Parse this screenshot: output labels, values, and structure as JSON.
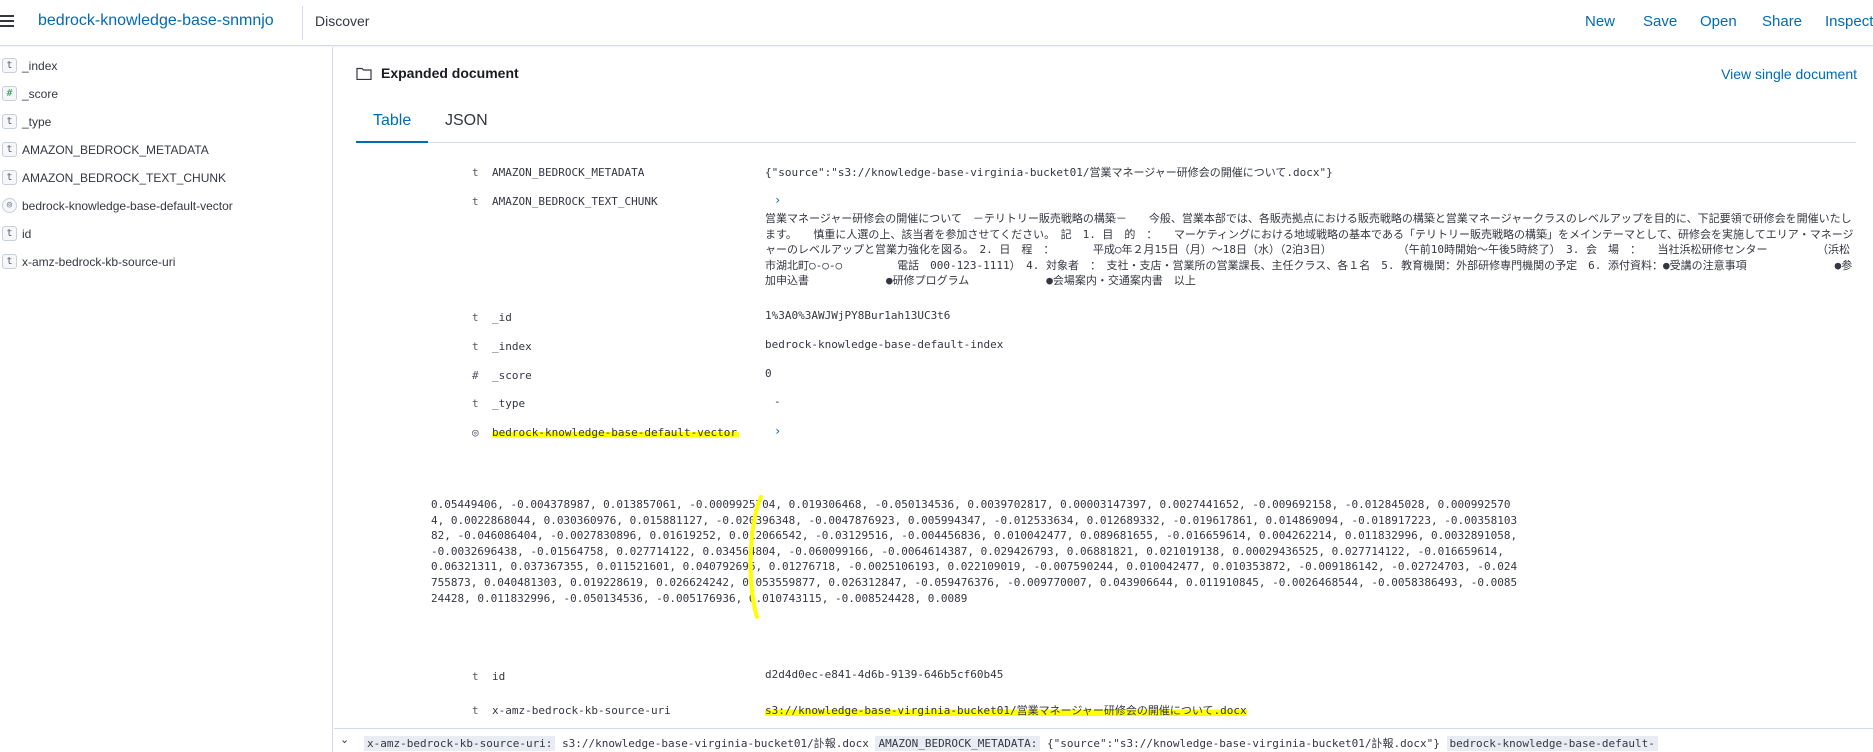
{
  "header": {
    "app_title": "bedrock-knowledge-base-snmnjo",
    "breadcrumb": "Discover",
    "nav": [
      "New",
      "Save",
      "Open",
      "Share",
      "Inspect"
    ]
  },
  "sidebar": {
    "fields": [
      {
        "type": "t",
        "name": "_index"
      },
      {
        "type": "#",
        "name": "_score"
      },
      {
        "type": "t",
        "name": "_type"
      },
      {
        "type": "t",
        "name": "AMAZON_BEDROCK_METADATA"
      },
      {
        "type": "t",
        "name": "AMAZON_BEDROCK_TEXT_CHUNK"
      },
      {
        "type": "◎",
        "name": "bedrock-knowledge-base-default-vector"
      },
      {
        "type": "t",
        "name": "id"
      },
      {
        "type": "t",
        "name": "x-amz-bedrock-kb-source-uri"
      }
    ]
  },
  "flyout": {
    "title": "Expanded document",
    "view_single": "View single document",
    "tabs": [
      "Table",
      "JSON"
    ]
  },
  "doc": {
    "metadata": {
      "type": "t",
      "name": "AMAZON_BEDROCK_METADATA",
      "value": "{\"source\":\"s3://knowledge-base-virginia-bucket01/営業マネージャー研修会の開催について.docx\"}"
    },
    "text_chunk": {
      "type": "t",
      "name": "AMAZON_BEDROCK_TEXT_CHUNK",
      "chevron": "›",
      "value": "営業マネージャー研修会の開催について　－テリトリー販売戦略の構築－　　今般、営業本部では、各販売拠点における販売戦略の構築と営業マネージャークラスのレベルアップを目的に、下記要領で研修会を開催いたします。　　慎重に人選の上、該当者を参加させてください。　記　1. 目　的　：　　マーケティングにおける地域戦略の基本である「テリトリー販売戦略の構築」をメインテーマとして、研修会を実施してエリア・マネージャーのレベルアップと営業力強化を図る。　2. 日　程　：　　　　平成○年２月15日（月）～18日（水）（2泊3日）　　　　　　　（午前10時開始～午後5時終了）　3. 会　場　：　　当社浜松研修センター　　　　　（浜松市湖北町○-○-○　　　　　電話　000-123-1111）　4. 対象者　：　支社・支店・営業所の営業課長、主任クラス、各１名　5. 教育機関：外部研修専門機関の予定　6. 添付資料：●受講の注意事項　　　　　　　　●参加申込書　　　　　　　●研修プログラム　　　　　　　●会場案内・交通案内書　以上"
    },
    "_id": {
      "type": "t",
      "name": "_id",
      "value": "1%3A0%3AWJWjPY8Bur1ah13UC3t6"
    },
    "_index": {
      "type": "t",
      "name": "_index",
      "value": "bedrock-knowledge-base-default-index"
    },
    "_score": {
      "type": "#",
      "name": "_score",
      "value": "0"
    },
    "_type": {
      "type": "t",
      "name": "_type",
      "value": "-"
    },
    "vector": {
      "type": "◎",
      "name": "bedrock-knowledge-base-default-vector",
      "chevron": "›",
      "value": "0.05449406, -0.004378987, 0.013857061, -0.0009925704, 0.019306468, -0.050134536, 0.0039702817, 0.00003147397, 0.0027441652, -0.009692158, -0.012845028, 0.0009925704, 0.0022868044, 0.030360976, 0.015881127, -0.020396348, -0.0047876923, 0.005994347, -0.012533634, 0.012689332, -0.019617861, 0.014869094, -0.018917223, -0.0035810382, -0.046086404, -0.0027830896, 0.01619252, 0.012066542, -0.03129516, -0.004456836, 0.010042477, 0.089681655, -0.016659614, 0.004262214, 0.011832996, 0.0032891058, -0.0032696438, -0.01564758, 0.027714122, 0.034564804, -0.060099166, -0.0064614387, 0.029426793, 0.06881821, 0.021019138, 0.00029436525, 0.027714122, -0.016659614, 0.06321311, 0.037367355, 0.011521601, 0.040792696, 0.01276718, -0.0025106193, 0.022109019, -0.007590244, 0.010042477, 0.010353872, -0.009186142, -0.02724703, -0.024755873, 0.040481303, 0.019228619, 0.026624242, 0.053559877, 0.026312847, -0.059476376, -0.009770007, 0.043906644, 0.011910845, -0.0026468544, -0.0058386493, -0.008524428, 0.011832996, -0.050134536, -0.005176936, 0.010743115, -0.008524428, 0.0089"
    },
    "id": {
      "type": "t",
      "name": "id",
      "value": "d2d4d0ec-e841-4d6b-9139-646b5cf60b45"
    },
    "source_uri": {
      "type": "t",
      "name": "x-amz-bedrock-kb-source-uri",
      "value": "s3://knowledge-base-virginia-bucket01/営業マネージャー研修会の開催について.docx"
    }
  },
  "bottom_row": {
    "chevron": "⌄",
    "k1": "x-amz-bedrock-kb-source-uri:",
    "v1": "s3://knowledge-base-virginia-bucket01/訃報.docx",
    "k2": "AMAZON_BEDROCK_METADATA:",
    "v2": "{\"source\":\"s3://knowledge-base-virginia-bucket01/訃報.docx\"}",
    "k3": "bedrock-knowledge-base-default-"
  },
  "colors": {
    "accent": "#006bb4",
    "highlight": "#ffff00"
  }
}
